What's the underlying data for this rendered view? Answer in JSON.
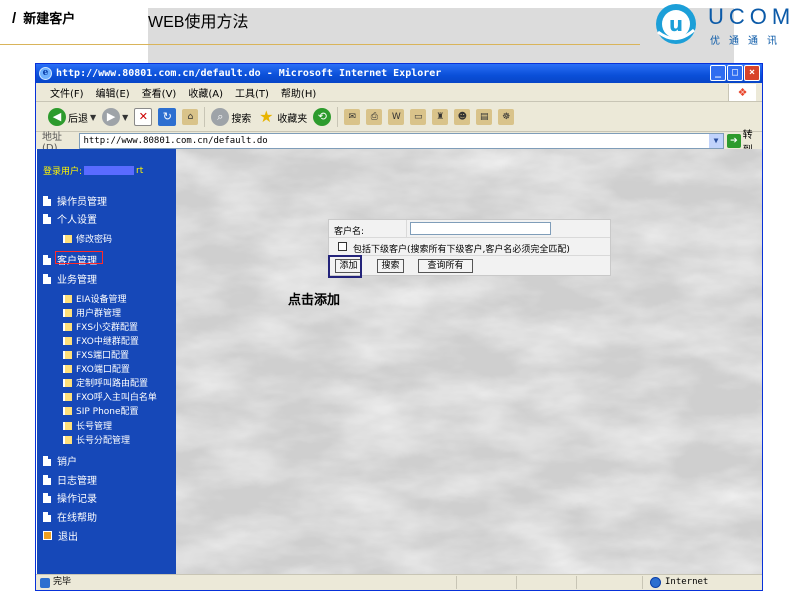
{
  "slide": {
    "title_main": "WEB使用方法",
    "title_sep": "/",
    "title_sub": "新建客户",
    "logo_brand": "UCOM",
    "logo_tagline": "优通通讯",
    "accent_color": "#0b5aa8"
  },
  "browser": {
    "title": "http://www.80801.com.cn/default.do - Microsoft Internet Explorer",
    "menu": [
      "文件(F)",
      "编辑(E)",
      "查看(V)",
      "收藏(A)",
      "工具(T)",
      "帮助(H)"
    ],
    "toolbar": {
      "back_label": "后退",
      "search_label": "搜索",
      "favorites_label": "收藏夹"
    },
    "address_label": "地址(D)",
    "address_value": "http://www.80801.com.cn/default.do",
    "go_label": "转到",
    "status_text": "完毕",
    "zone_text": "Internet"
  },
  "sidebar": {
    "login_prefix": "登录用户:",
    "login_suffix": "rt",
    "items": [
      {
        "label": "操作员管理"
      },
      {
        "label": "个人设置"
      },
      {
        "label": "修改密码"
      },
      {
        "label": "客户管理"
      },
      {
        "label": "业务管理"
      },
      {
        "label": "EIA设备管理"
      },
      {
        "label": "用户群管理"
      },
      {
        "label": "FXS小交群配置"
      },
      {
        "label": "FXO中继群配置"
      },
      {
        "label": "FXS端口配置"
      },
      {
        "label": "FXO端口配置"
      },
      {
        "label": "定制呼叫路由配置"
      },
      {
        "label": "FXO呼入主叫白名单"
      },
      {
        "label": "SIP Phone配置"
      },
      {
        "label": "长号管理"
      },
      {
        "label": "长号分配管理"
      },
      {
        "label": "销户"
      },
      {
        "label": "日志管理"
      },
      {
        "label": "操作记录"
      },
      {
        "label": "在线帮助"
      },
      {
        "label": "退出"
      }
    ]
  },
  "form": {
    "customer_name_label": "客户名:",
    "customer_name_value": "",
    "include_sub_label": "包括下级客户(搜索所有下级客户,客户名必须完全匹配)",
    "add_button": "添加",
    "search_button": "搜索",
    "query_all_button": "查询所有"
  },
  "annotation": "点击添加"
}
